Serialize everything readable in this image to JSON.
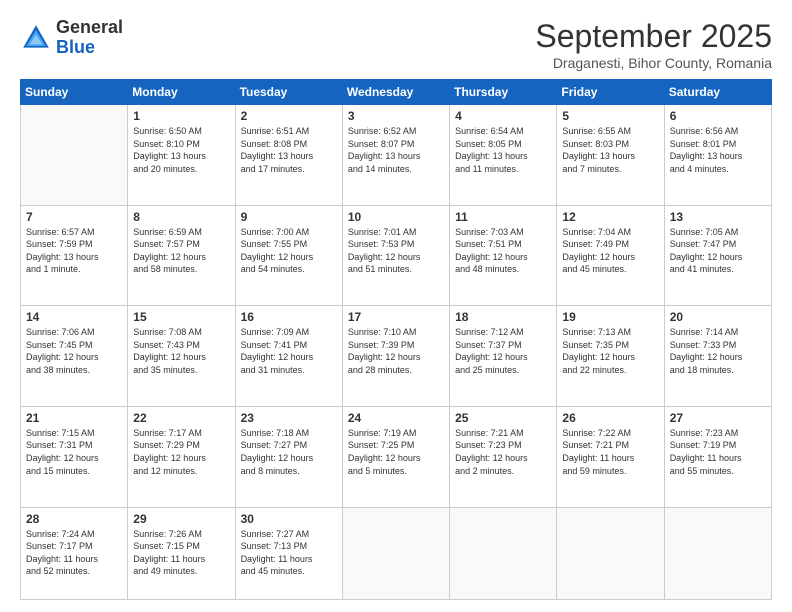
{
  "logo": {
    "general": "General",
    "blue": "Blue"
  },
  "header": {
    "month": "September 2025",
    "location": "Draganesti, Bihor County, Romania"
  },
  "weekdays": [
    "Sunday",
    "Monday",
    "Tuesday",
    "Wednesday",
    "Thursday",
    "Friday",
    "Saturday"
  ],
  "weeks": [
    [
      {
        "day": "",
        "info": ""
      },
      {
        "day": "1",
        "info": "Sunrise: 6:50 AM\nSunset: 8:10 PM\nDaylight: 13 hours\nand 20 minutes."
      },
      {
        "day": "2",
        "info": "Sunrise: 6:51 AM\nSunset: 8:08 PM\nDaylight: 13 hours\nand 17 minutes."
      },
      {
        "day": "3",
        "info": "Sunrise: 6:52 AM\nSunset: 8:07 PM\nDaylight: 13 hours\nand 14 minutes."
      },
      {
        "day": "4",
        "info": "Sunrise: 6:54 AM\nSunset: 8:05 PM\nDaylight: 13 hours\nand 11 minutes."
      },
      {
        "day": "5",
        "info": "Sunrise: 6:55 AM\nSunset: 8:03 PM\nDaylight: 13 hours\nand 7 minutes."
      },
      {
        "day": "6",
        "info": "Sunrise: 6:56 AM\nSunset: 8:01 PM\nDaylight: 13 hours\nand 4 minutes."
      }
    ],
    [
      {
        "day": "7",
        "info": "Sunrise: 6:57 AM\nSunset: 7:59 PM\nDaylight: 13 hours\nand 1 minute."
      },
      {
        "day": "8",
        "info": "Sunrise: 6:59 AM\nSunset: 7:57 PM\nDaylight: 12 hours\nand 58 minutes."
      },
      {
        "day": "9",
        "info": "Sunrise: 7:00 AM\nSunset: 7:55 PM\nDaylight: 12 hours\nand 54 minutes."
      },
      {
        "day": "10",
        "info": "Sunrise: 7:01 AM\nSunset: 7:53 PM\nDaylight: 12 hours\nand 51 minutes."
      },
      {
        "day": "11",
        "info": "Sunrise: 7:03 AM\nSunset: 7:51 PM\nDaylight: 12 hours\nand 48 minutes."
      },
      {
        "day": "12",
        "info": "Sunrise: 7:04 AM\nSunset: 7:49 PM\nDaylight: 12 hours\nand 45 minutes."
      },
      {
        "day": "13",
        "info": "Sunrise: 7:05 AM\nSunset: 7:47 PM\nDaylight: 12 hours\nand 41 minutes."
      }
    ],
    [
      {
        "day": "14",
        "info": "Sunrise: 7:06 AM\nSunset: 7:45 PM\nDaylight: 12 hours\nand 38 minutes."
      },
      {
        "day": "15",
        "info": "Sunrise: 7:08 AM\nSunset: 7:43 PM\nDaylight: 12 hours\nand 35 minutes."
      },
      {
        "day": "16",
        "info": "Sunrise: 7:09 AM\nSunset: 7:41 PM\nDaylight: 12 hours\nand 31 minutes."
      },
      {
        "day": "17",
        "info": "Sunrise: 7:10 AM\nSunset: 7:39 PM\nDaylight: 12 hours\nand 28 minutes."
      },
      {
        "day": "18",
        "info": "Sunrise: 7:12 AM\nSunset: 7:37 PM\nDaylight: 12 hours\nand 25 minutes."
      },
      {
        "day": "19",
        "info": "Sunrise: 7:13 AM\nSunset: 7:35 PM\nDaylight: 12 hours\nand 22 minutes."
      },
      {
        "day": "20",
        "info": "Sunrise: 7:14 AM\nSunset: 7:33 PM\nDaylight: 12 hours\nand 18 minutes."
      }
    ],
    [
      {
        "day": "21",
        "info": "Sunrise: 7:15 AM\nSunset: 7:31 PM\nDaylight: 12 hours\nand 15 minutes."
      },
      {
        "day": "22",
        "info": "Sunrise: 7:17 AM\nSunset: 7:29 PM\nDaylight: 12 hours\nand 12 minutes."
      },
      {
        "day": "23",
        "info": "Sunrise: 7:18 AM\nSunset: 7:27 PM\nDaylight: 12 hours\nand 8 minutes."
      },
      {
        "day": "24",
        "info": "Sunrise: 7:19 AM\nSunset: 7:25 PM\nDaylight: 12 hours\nand 5 minutes."
      },
      {
        "day": "25",
        "info": "Sunrise: 7:21 AM\nSunset: 7:23 PM\nDaylight: 12 hours\nand 2 minutes."
      },
      {
        "day": "26",
        "info": "Sunrise: 7:22 AM\nSunset: 7:21 PM\nDaylight: 11 hours\nand 59 minutes."
      },
      {
        "day": "27",
        "info": "Sunrise: 7:23 AM\nSunset: 7:19 PM\nDaylight: 11 hours\nand 55 minutes."
      }
    ],
    [
      {
        "day": "28",
        "info": "Sunrise: 7:24 AM\nSunset: 7:17 PM\nDaylight: 11 hours\nand 52 minutes."
      },
      {
        "day": "29",
        "info": "Sunrise: 7:26 AM\nSunset: 7:15 PM\nDaylight: 11 hours\nand 49 minutes."
      },
      {
        "day": "30",
        "info": "Sunrise: 7:27 AM\nSunset: 7:13 PM\nDaylight: 11 hours\nand 45 minutes."
      },
      {
        "day": "",
        "info": ""
      },
      {
        "day": "",
        "info": ""
      },
      {
        "day": "",
        "info": ""
      },
      {
        "day": "",
        "info": ""
      }
    ]
  ]
}
